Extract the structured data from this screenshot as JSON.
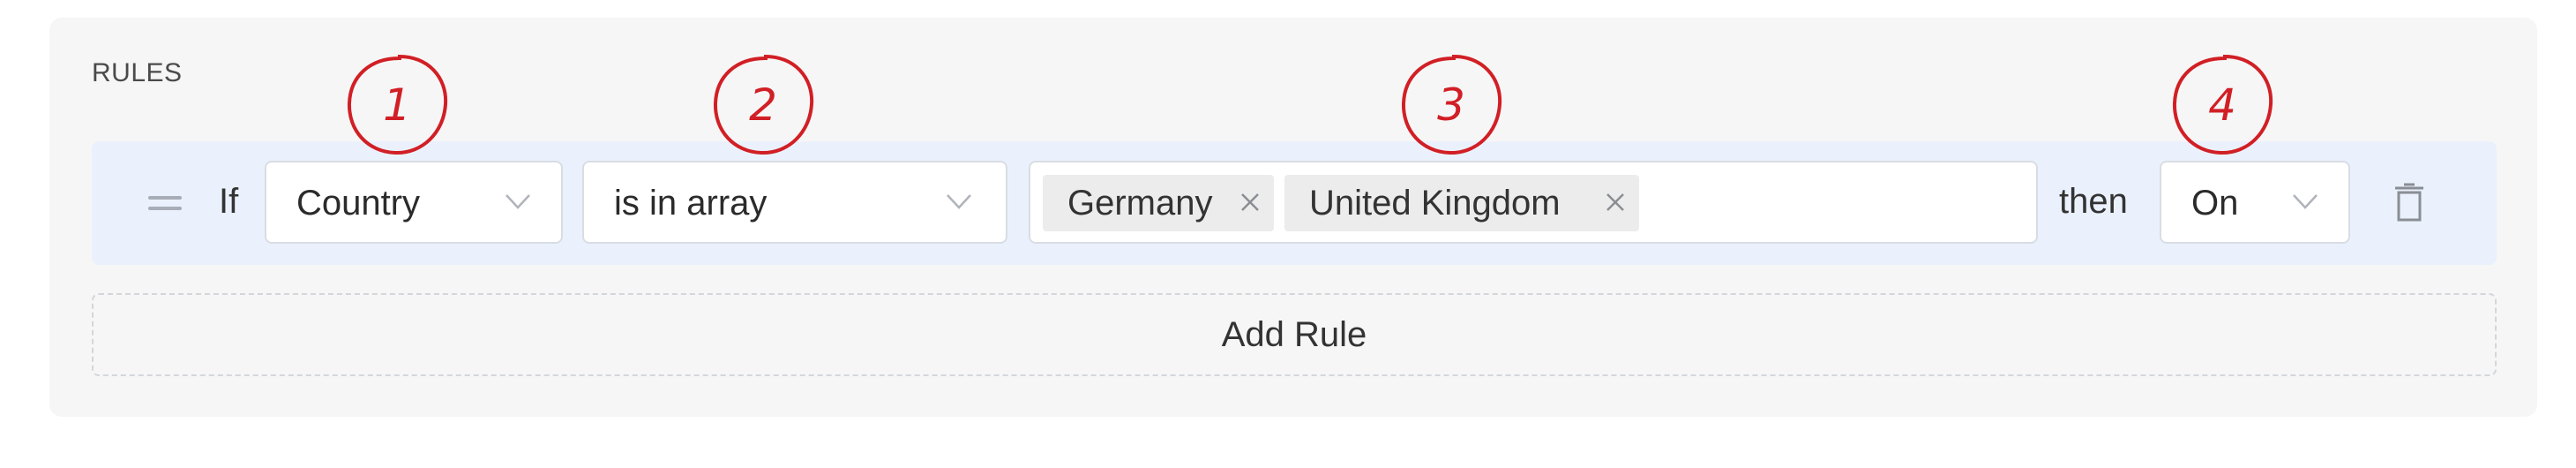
{
  "section_title": "RULES",
  "rule": {
    "if_label": "If",
    "field": "Country",
    "operator": "is in array",
    "values": [
      "Germany",
      "United Kingdom"
    ],
    "then_label": "then",
    "result": "On"
  },
  "add_rule_label": "Add Rule",
  "markers": [
    "1",
    "2",
    "3",
    "4"
  ],
  "colors": {
    "panel_bg": "#f6f6f6",
    "row_bg": "#eaf1fd",
    "marker": "#d11f25"
  },
  "icons": {
    "drag": "drag-handle-icon",
    "chevron": "chevron-down-icon",
    "remove": "close-icon",
    "delete": "trash-icon"
  }
}
